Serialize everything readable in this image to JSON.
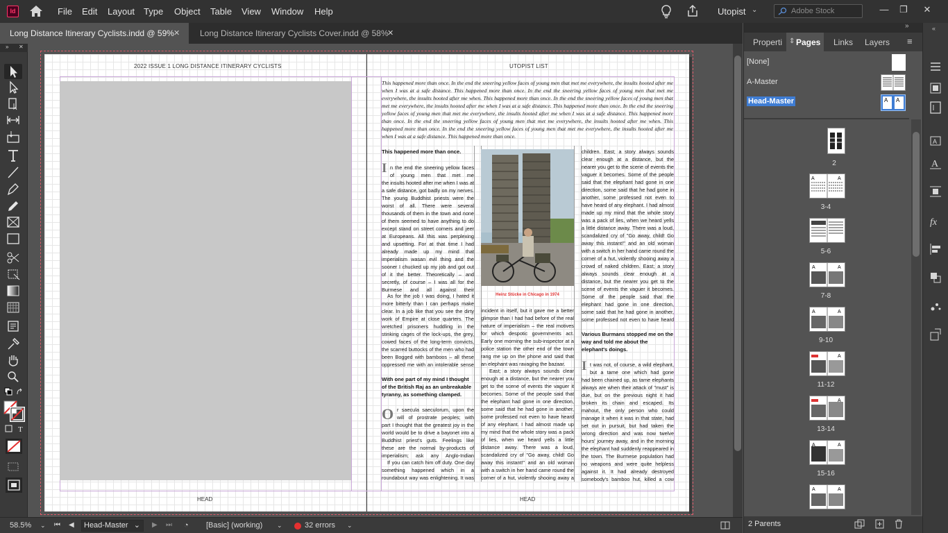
{
  "app": {
    "logo": "Id"
  },
  "menu": [
    "File",
    "Edit",
    "Layout",
    "Type",
    "Object",
    "Table",
    "View",
    "Window",
    "Help"
  ],
  "workspace": "Utopist",
  "search": {
    "placeholder": "Adobe Stock"
  },
  "tabs": [
    {
      "label": "Long Distance Itinerary Cyclists.indd @ 59%",
      "active": true
    },
    {
      "label": "Long Distance Itinerary Cyclists Cover.indd @ 58%",
      "active": false
    }
  ],
  "spread": {
    "left_running_head": "2022   ISSUE 1   LONG DISTANCE ITINERARY CYCLISTS",
    "right_running_head": "UTOPIST LIST",
    "left_folio": "HEAD",
    "right_folio": "HEAD",
    "intro": "This happened more than once. In the end the sneering yellow faces of young men that met me everywhere, the insults hooted after me when I was at a safe distance. This happened more than once. In the end the sneering yellow faces of young men that met me everywhere, the insults hooted after me when. This happened more than once. In the end the sneering yellow faces of young men that met me everywhere, the insults hooted after me when I was at a safe distance. This happened more than once. In the end the sneering yellow faces of young men that met me everywhere, the insults hooted after me when I was at a safe distance. This happened more than once. In the end the sneering yellow faces of young men that met me everywhere, the insults hooted after me when. This happened more than once. In the end the sneering yellow faces of young men that met me everywhere, the insults hooted after me when I was at a safe distance. This happened more than once.",
    "col1_subhead1": "This happened more than once.",
    "col1_dropcap1": "I",
    "col1_text1": "n the end the sneering yellow faces of young men that met me everywhere, the insults hooted after me when I was at a safe distance, got badly on my nerves. The young Buddhist priests were the worst of all. There were several thousands of them in the town and none of them seemed to have anything to do except stand on street corners and jeer at Europeans. All this was perplexing and upsetting. For at that time I had already made up my mind that imperialism wasan evil thing and the sooner I chucked up my job and got out of it the better. Theoretically – and secretly, of course – I was all for the Burmese and all against their oppressors, the British.",
    "col1_text2": "As for the job I was doing, I hated it more bitterly than I can perhaps make clear. In a job like that you see the dirty work of Empire at close quarters. The wretched prisoners huddling in the stinking cages of the lock-ups, the grey, cowed faces of the long-term convicts, the scarred buttocks of the men who had been Bogged with bamboos – all these oppressed me with an intolerable sense of guilt.",
    "col1_subhead2": "With one part of my mind I thought of the British Raj as an unbreakable tyranny, as something clamped.",
    "col1_dropcap2": "O",
    "col1_text3": "r saecula saeculorum, upon the will of prostrate peoples; with another part I thought that the greatest joy in the world would be to drive a bayonet into a Buddhist priest's guts. Feelings like these are the normal by-products of imperialism; ask any Anglo-Indian official.",
    "col1_text4": "If you can catch him off duty. One day something happened which in a roundabout way was enlightening. It was a tiny",
    "photo_caption": "Heinz Stücke in Chicago in 1974",
    "col2_text": "incident in itself, but it gave me a better glimpse than I had had before of the real nature of imperialism – the real motives for which despotic governments act. Early one morning the sub-inspector at a police station the other end of the town rang me up on the phone and said that an elephant was ravaging the bazaar.",
    "col2_text2": "East; a story always sounds clear enough at a distance, but the nearer you get to the scene of events the vaguer it becomes. Some of the people said that the elephant had gone in one direction, some said that he had gone in another, some professed not even to have heard of any elephant. I had almost made up my mind that the whole story was a pack of lies, when we heard yells a little distance away. There was a loud, scandalized cry of \"Go away, child! Go away this instant!\" and an old woman with a switch in her hand came round the corner of a hut, violently shooing away a crowd of naked",
    "col3_text1": "children. East; a story always sounds clear enough at a distance, but the nearer you get to the scene of events the vaguer it becomes. Some of the people said that the elephant had gone in one direction, some said that he had gone in another, some professed not even to have heard of any elephant. I had almost made up my mind that the whole story was a pack of lies, when we heard yells a little distance away. There was a loud, scandalized cry of \"Go away, child! Go away this instant!\" and an old woman with a switch in her hand came round the corner of a hut, violently shooing away a crowd of naked children. East; a story always sounds clear enough at a distance, but the nearer you get to the scene of events the vaguer it becomes. Some of the people said that the elephant had gone in one direction, some said that he had gone in another, some professed not even to have heard of any elephant. I had almost made up my mind.",
    "col3_subhead": "Various Burmans stopped me on the way and told me about the elephant's doings.",
    "col3_dropcap": "I",
    "col3_text2": "t was not, of course, a wild elephant, but a tame one which had gone \"must.\" It had been chained up, as tame elephants always are when their attack of \"must\" is due, but on the previous night it had broken its chain and escaped. Its mahout, the only person who could manage it when it was in that state, had set out in pursuit, but had taken the wrong direction and was now twelve hours' journey away, and in the morning the elephant had suddenly reappeared in the town. The Burmese population had no weapons and were quite helpless against it. It had already destroyed somebody's bamboo hut, killed a cow and raided some"
  },
  "status": {
    "zoom": "58.5%",
    "page": "Head-Master",
    "preflight_profile": "[Basic] (working)",
    "errors": "32 errors"
  },
  "panel": {
    "tabs": [
      "Properti",
      "Pages",
      "Links",
      "Layers"
    ],
    "masters": [
      {
        "label": "[None]"
      },
      {
        "label": "A-Master"
      },
      {
        "label": "Head-Master",
        "selected": true
      }
    ],
    "pages": [
      "2",
      "3-4",
      "5-6",
      "7-8",
      "9-10",
      "11-12",
      "13-14",
      "15-16"
    ],
    "footer": "2 Parents"
  },
  "colors": {
    "accent": "#4a90e2",
    "error": "#e53030",
    "bleed": "#e05a6a"
  }
}
